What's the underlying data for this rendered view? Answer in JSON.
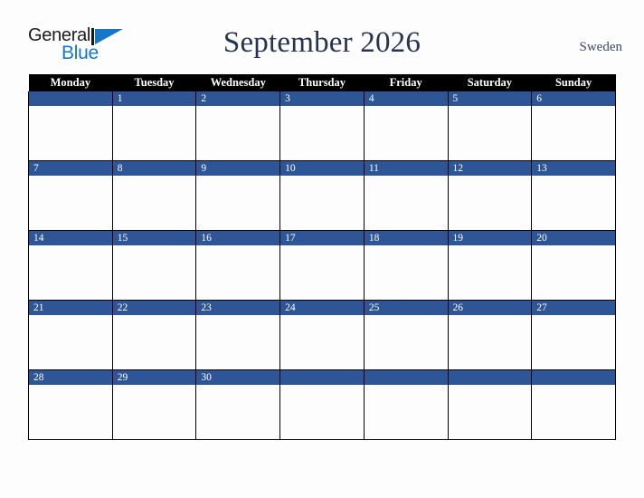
{
  "brand": {
    "name_part1": "General",
    "name_part2": "Blue",
    "logo_mark": "triangle-icon"
  },
  "header": {
    "title": "September 2026",
    "country": "Sweden"
  },
  "colors": {
    "day_band": "#2e5596",
    "header_row": "#000000",
    "title_text": "#27344f",
    "brand_blue": "#1477ca",
    "page_background": "#fdfdfd"
  },
  "calendar": {
    "weekday_headers": [
      "Monday",
      "Tuesday",
      "Wednesday",
      "Thursday",
      "Friday",
      "Saturday",
      "Sunday"
    ],
    "weeks": [
      [
        "",
        "1",
        "2",
        "3",
        "4",
        "5",
        "6"
      ],
      [
        "7",
        "8",
        "9",
        "10",
        "11",
        "12",
        "13"
      ],
      [
        "14",
        "15",
        "16",
        "17",
        "18",
        "19",
        "20"
      ],
      [
        "21",
        "22",
        "23",
        "24",
        "25",
        "26",
        "27"
      ],
      [
        "28",
        "29",
        "30",
        "",
        "",
        "",
        ""
      ]
    ]
  }
}
